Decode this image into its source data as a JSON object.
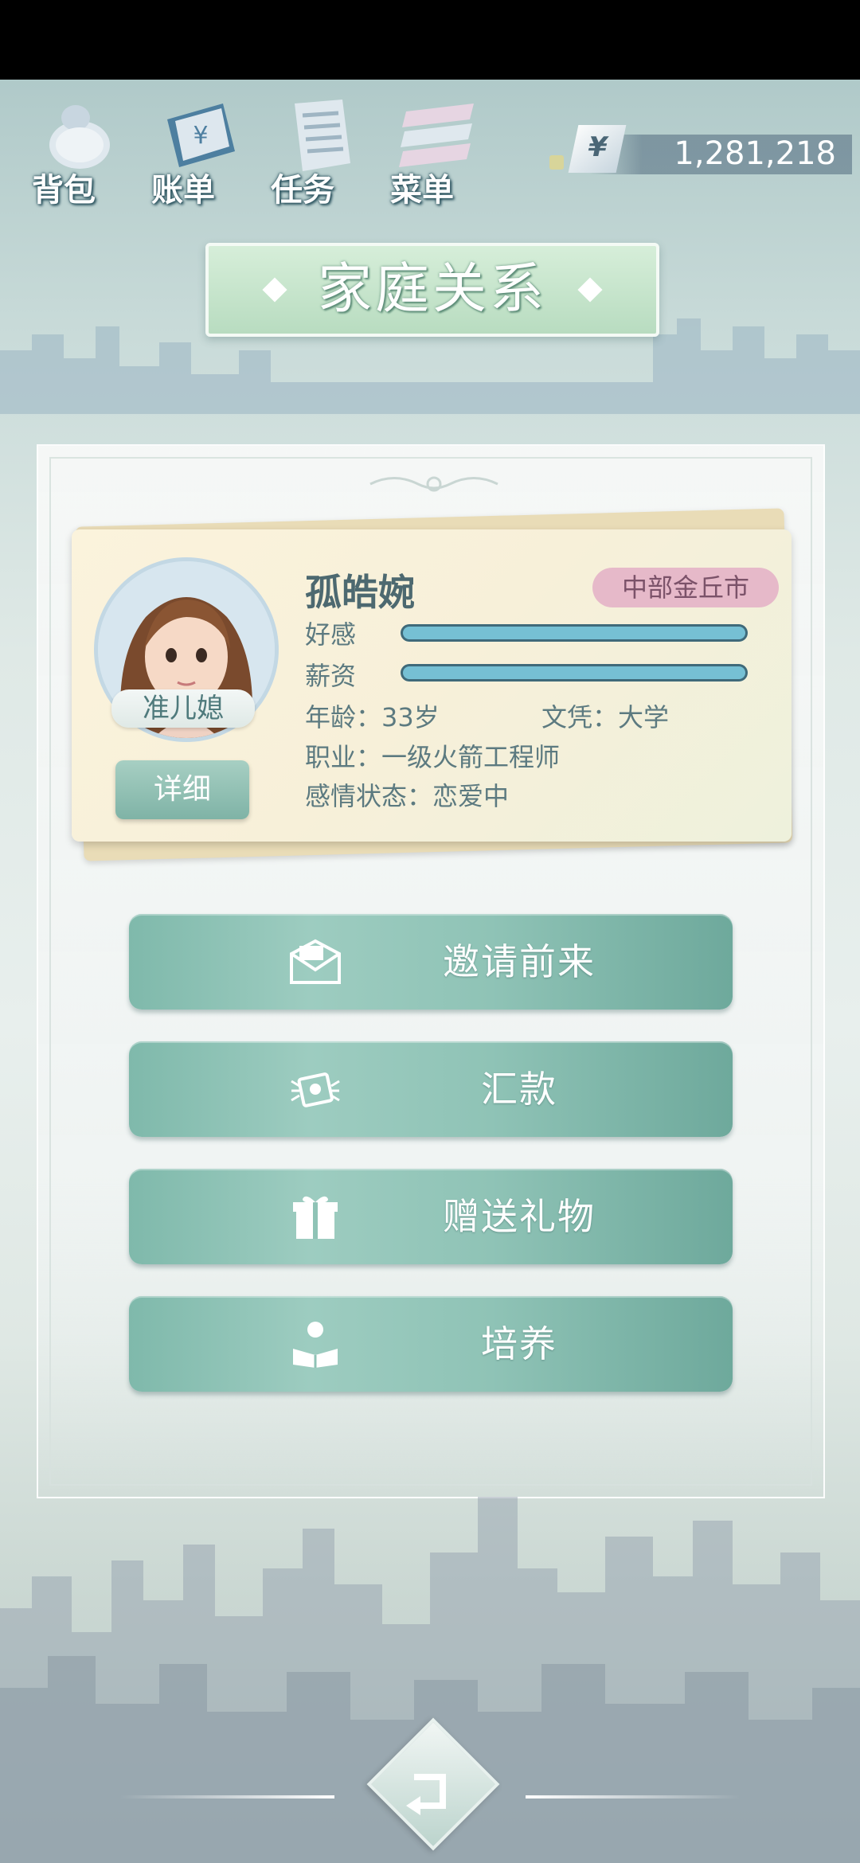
{
  "nav": {
    "items": [
      {
        "label": "背包",
        "icon": "bag-icon"
      },
      {
        "label": "账单",
        "icon": "bill-icon"
      },
      {
        "label": "任务",
        "icon": "task-icon"
      },
      {
        "label": "菜单",
        "icon": "menu-icon"
      }
    ]
  },
  "wallet": {
    "currency_symbol": "¥",
    "amount": "1,281,218"
  },
  "page": {
    "title": "家庭关系"
  },
  "character": {
    "name": "孤皓婉",
    "location": "中部金丘市",
    "relation": "准儿媳",
    "detail_label": "详细",
    "favor_label": "好感",
    "favor_level": 1.0,
    "salary_label": "薪资",
    "salary_level": 1.0,
    "age_text": "年龄：33岁",
    "education_text": "文凭：大学",
    "job_text": "职业：一级火箭工程师",
    "relationship_text": "感情状态：恋爱中"
  },
  "actions": [
    {
      "label": "邀请前来",
      "icon": "invite-letter-icon"
    },
    {
      "label": "汇款",
      "icon": "money-transfer-icon"
    },
    {
      "label": "赠送礼物",
      "icon": "gift-icon"
    },
    {
      "label": "培养",
      "icon": "reading-person-icon"
    }
  ],
  "colors": {
    "button_teal": "#8fc3b6",
    "bar_fill": "#76c0d4",
    "location_badge": "#e6b9c9"
  }
}
